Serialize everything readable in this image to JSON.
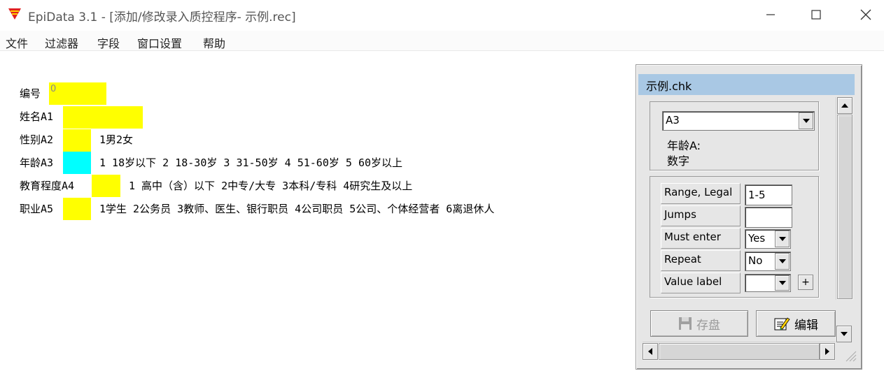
{
  "window": {
    "title": "EpiData 3.1 - [添加/修改录入质控程序- 示例.rec]",
    "minimize_icon": "minimize-icon",
    "maximize_icon": "maximize-icon",
    "close_icon": "close-icon"
  },
  "menu": [
    "文件",
    "过滤器",
    "字段",
    "窗口设置",
    "帮助"
  ],
  "form": {
    "fields": [
      {
        "label": "编号",
        "value": "0",
        "description": ""
      },
      {
        "label": "姓名A1",
        "value": "",
        "description": ""
      },
      {
        "label": "性别A2",
        "value": "",
        "description": "1男2女"
      },
      {
        "label": "年龄A3",
        "value": "",
        "description": "1 18岁以下 2 18-30岁 3 31-50岁 4 51-60岁 5 60岁以上"
      },
      {
        "label": "教育程度A4",
        "value": "",
        "description": "1 高中（含）以下 2中专/大专 3本科/专科 4研究生及以上"
      },
      {
        "label": "职业A5",
        "value": "",
        "description": "1学生 2公务员 3教师、医生、银行职员 4公司职员 5公司、个体经营者 6离退休人"
      }
    ],
    "colors": {
      "field": "#ffff00",
      "active_field": "#00ffff"
    }
  },
  "check_panel": {
    "title": "示例.chk",
    "field_select": "A3",
    "field_label": "年龄A:",
    "field_type": "数字",
    "props": [
      {
        "label": "Range, Legal",
        "value": "1-5"
      },
      {
        "label": "Jumps",
        "value": ""
      },
      {
        "label": "Must enter",
        "value": "Yes"
      },
      {
        "label": "Repeat",
        "value": "No"
      },
      {
        "label": "Value label",
        "value": ""
      }
    ],
    "plus_label": "+",
    "save_label": "存盘",
    "edit_label": "编辑",
    "title_color": "#a9c8e4"
  }
}
